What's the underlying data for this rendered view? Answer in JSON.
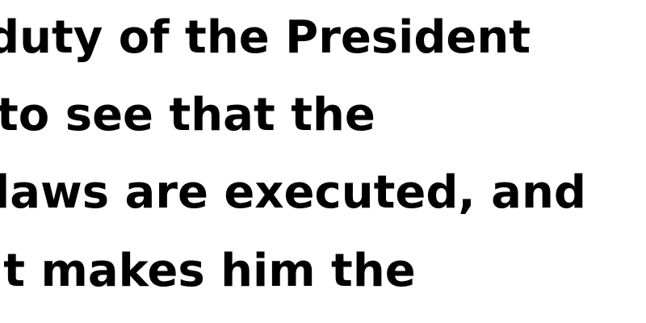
{
  "text_lines": [
    "duty of the President",
    "to see that the",
    "laws are executed, and",
    "it makes him the"
  ]
}
